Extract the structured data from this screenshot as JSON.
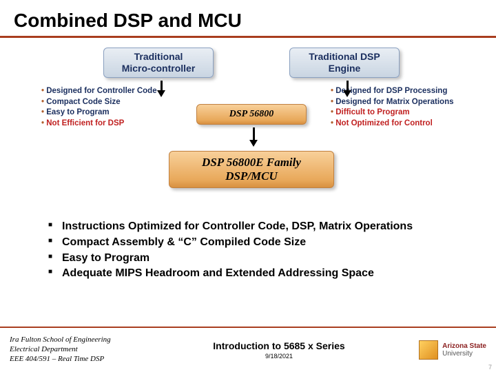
{
  "title": "Combined DSP and MCU",
  "boxes": {
    "mcu": {
      "line1": "Traditional",
      "line2": "Micro-controller"
    },
    "dsp": {
      "line1": "Traditional DSP",
      "line2": "Engine"
    },
    "mid": "DSP 56800",
    "family": {
      "line1": "DSP 56800E Family",
      "line2": "DSP/MCU"
    }
  },
  "left_feats": [
    {
      "t": "Designed for Controller Code",
      "red": false
    },
    {
      "t": "Compact Code Size",
      "red": false
    },
    {
      "t": "Easy to Program",
      "red": false
    },
    {
      "t": "Not Efficient for DSP",
      "red": true
    }
  ],
  "right_feats": [
    {
      "t": "Designed for DSP Processing",
      "red": false
    },
    {
      "t": "Designed for Matrix Operations",
      "red": false
    },
    {
      "t": "Difficult to Program",
      "red": true
    },
    {
      "t": "Not Optimized for Control",
      "red": true
    }
  ],
  "bullets": [
    "Instructions Optimized for Controller Code, DSP, Matrix Operations",
    "Compact Assembly & “C” Compiled Code Size",
    "Easy to Program",
    "Adequate MIPS Headroom and Extended Addressing Space"
  ],
  "footer": {
    "line1": "Ira Fulton School of Engineering",
    "line2": "Electrical Department",
    "line3": "EEE 404/591 – Real Time DSP",
    "center_title": "Introduction to 5685 x Series",
    "date": "9/18/2021",
    "uni1": "Arizona State",
    "uni2": "University",
    "slide": "7"
  }
}
